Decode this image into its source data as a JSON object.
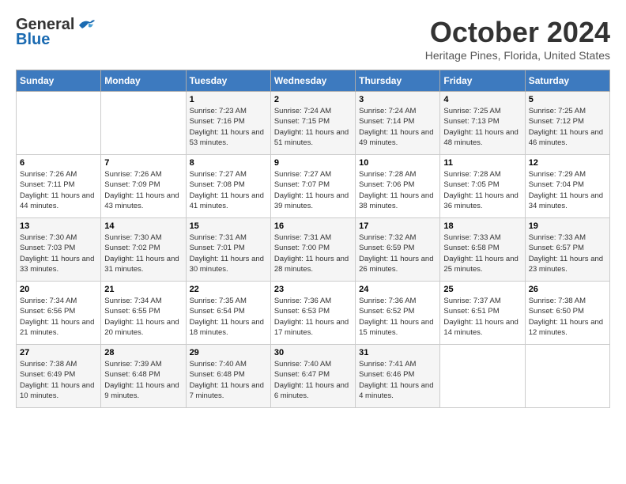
{
  "header": {
    "logo_line1": "General",
    "logo_line2": "Blue",
    "month_title": "October 2024",
    "location": "Heritage Pines, Florida, United States"
  },
  "days_of_week": [
    "Sunday",
    "Monday",
    "Tuesday",
    "Wednesday",
    "Thursday",
    "Friday",
    "Saturday"
  ],
  "weeks": [
    [
      {
        "day": "",
        "info": ""
      },
      {
        "day": "",
        "info": ""
      },
      {
        "day": "1",
        "info": "Sunrise: 7:23 AM\nSunset: 7:16 PM\nDaylight: 11 hours and 53 minutes."
      },
      {
        "day": "2",
        "info": "Sunrise: 7:24 AM\nSunset: 7:15 PM\nDaylight: 11 hours and 51 minutes."
      },
      {
        "day": "3",
        "info": "Sunrise: 7:24 AM\nSunset: 7:14 PM\nDaylight: 11 hours and 49 minutes."
      },
      {
        "day": "4",
        "info": "Sunrise: 7:25 AM\nSunset: 7:13 PM\nDaylight: 11 hours and 48 minutes."
      },
      {
        "day": "5",
        "info": "Sunrise: 7:25 AM\nSunset: 7:12 PM\nDaylight: 11 hours and 46 minutes."
      }
    ],
    [
      {
        "day": "6",
        "info": "Sunrise: 7:26 AM\nSunset: 7:11 PM\nDaylight: 11 hours and 44 minutes."
      },
      {
        "day": "7",
        "info": "Sunrise: 7:26 AM\nSunset: 7:09 PM\nDaylight: 11 hours and 43 minutes."
      },
      {
        "day": "8",
        "info": "Sunrise: 7:27 AM\nSunset: 7:08 PM\nDaylight: 11 hours and 41 minutes."
      },
      {
        "day": "9",
        "info": "Sunrise: 7:27 AM\nSunset: 7:07 PM\nDaylight: 11 hours and 39 minutes."
      },
      {
        "day": "10",
        "info": "Sunrise: 7:28 AM\nSunset: 7:06 PM\nDaylight: 11 hours and 38 minutes."
      },
      {
        "day": "11",
        "info": "Sunrise: 7:28 AM\nSunset: 7:05 PM\nDaylight: 11 hours and 36 minutes."
      },
      {
        "day": "12",
        "info": "Sunrise: 7:29 AM\nSunset: 7:04 PM\nDaylight: 11 hours and 34 minutes."
      }
    ],
    [
      {
        "day": "13",
        "info": "Sunrise: 7:30 AM\nSunset: 7:03 PM\nDaylight: 11 hours and 33 minutes."
      },
      {
        "day": "14",
        "info": "Sunrise: 7:30 AM\nSunset: 7:02 PM\nDaylight: 11 hours and 31 minutes."
      },
      {
        "day": "15",
        "info": "Sunrise: 7:31 AM\nSunset: 7:01 PM\nDaylight: 11 hours and 30 minutes."
      },
      {
        "day": "16",
        "info": "Sunrise: 7:31 AM\nSunset: 7:00 PM\nDaylight: 11 hours and 28 minutes."
      },
      {
        "day": "17",
        "info": "Sunrise: 7:32 AM\nSunset: 6:59 PM\nDaylight: 11 hours and 26 minutes."
      },
      {
        "day": "18",
        "info": "Sunrise: 7:33 AM\nSunset: 6:58 PM\nDaylight: 11 hours and 25 minutes."
      },
      {
        "day": "19",
        "info": "Sunrise: 7:33 AM\nSunset: 6:57 PM\nDaylight: 11 hours and 23 minutes."
      }
    ],
    [
      {
        "day": "20",
        "info": "Sunrise: 7:34 AM\nSunset: 6:56 PM\nDaylight: 11 hours and 21 minutes."
      },
      {
        "day": "21",
        "info": "Sunrise: 7:34 AM\nSunset: 6:55 PM\nDaylight: 11 hours and 20 minutes."
      },
      {
        "day": "22",
        "info": "Sunrise: 7:35 AM\nSunset: 6:54 PM\nDaylight: 11 hours and 18 minutes."
      },
      {
        "day": "23",
        "info": "Sunrise: 7:36 AM\nSunset: 6:53 PM\nDaylight: 11 hours and 17 minutes."
      },
      {
        "day": "24",
        "info": "Sunrise: 7:36 AM\nSunset: 6:52 PM\nDaylight: 11 hours and 15 minutes."
      },
      {
        "day": "25",
        "info": "Sunrise: 7:37 AM\nSunset: 6:51 PM\nDaylight: 11 hours and 14 minutes."
      },
      {
        "day": "26",
        "info": "Sunrise: 7:38 AM\nSunset: 6:50 PM\nDaylight: 11 hours and 12 minutes."
      }
    ],
    [
      {
        "day": "27",
        "info": "Sunrise: 7:38 AM\nSunset: 6:49 PM\nDaylight: 11 hours and 10 minutes."
      },
      {
        "day": "28",
        "info": "Sunrise: 7:39 AM\nSunset: 6:48 PM\nDaylight: 11 hours and 9 minutes."
      },
      {
        "day": "29",
        "info": "Sunrise: 7:40 AM\nSunset: 6:48 PM\nDaylight: 11 hours and 7 minutes."
      },
      {
        "day": "30",
        "info": "Sunrise: 7:40 AM\nSunset: 6:47 PM\nDaylight: 11 hours and 6 minutes."
      },
      {
        "day": "31",
        "info": "Sunrise: 7:41 AM\nSunset: 6:46 PM\nDaylight: 11 hours and 4 minutes."
      },
      {
        "day": "",
        "info": ""
      },
      {
        "day": "",
        "info": ""
      }
    ]
  ]
}
